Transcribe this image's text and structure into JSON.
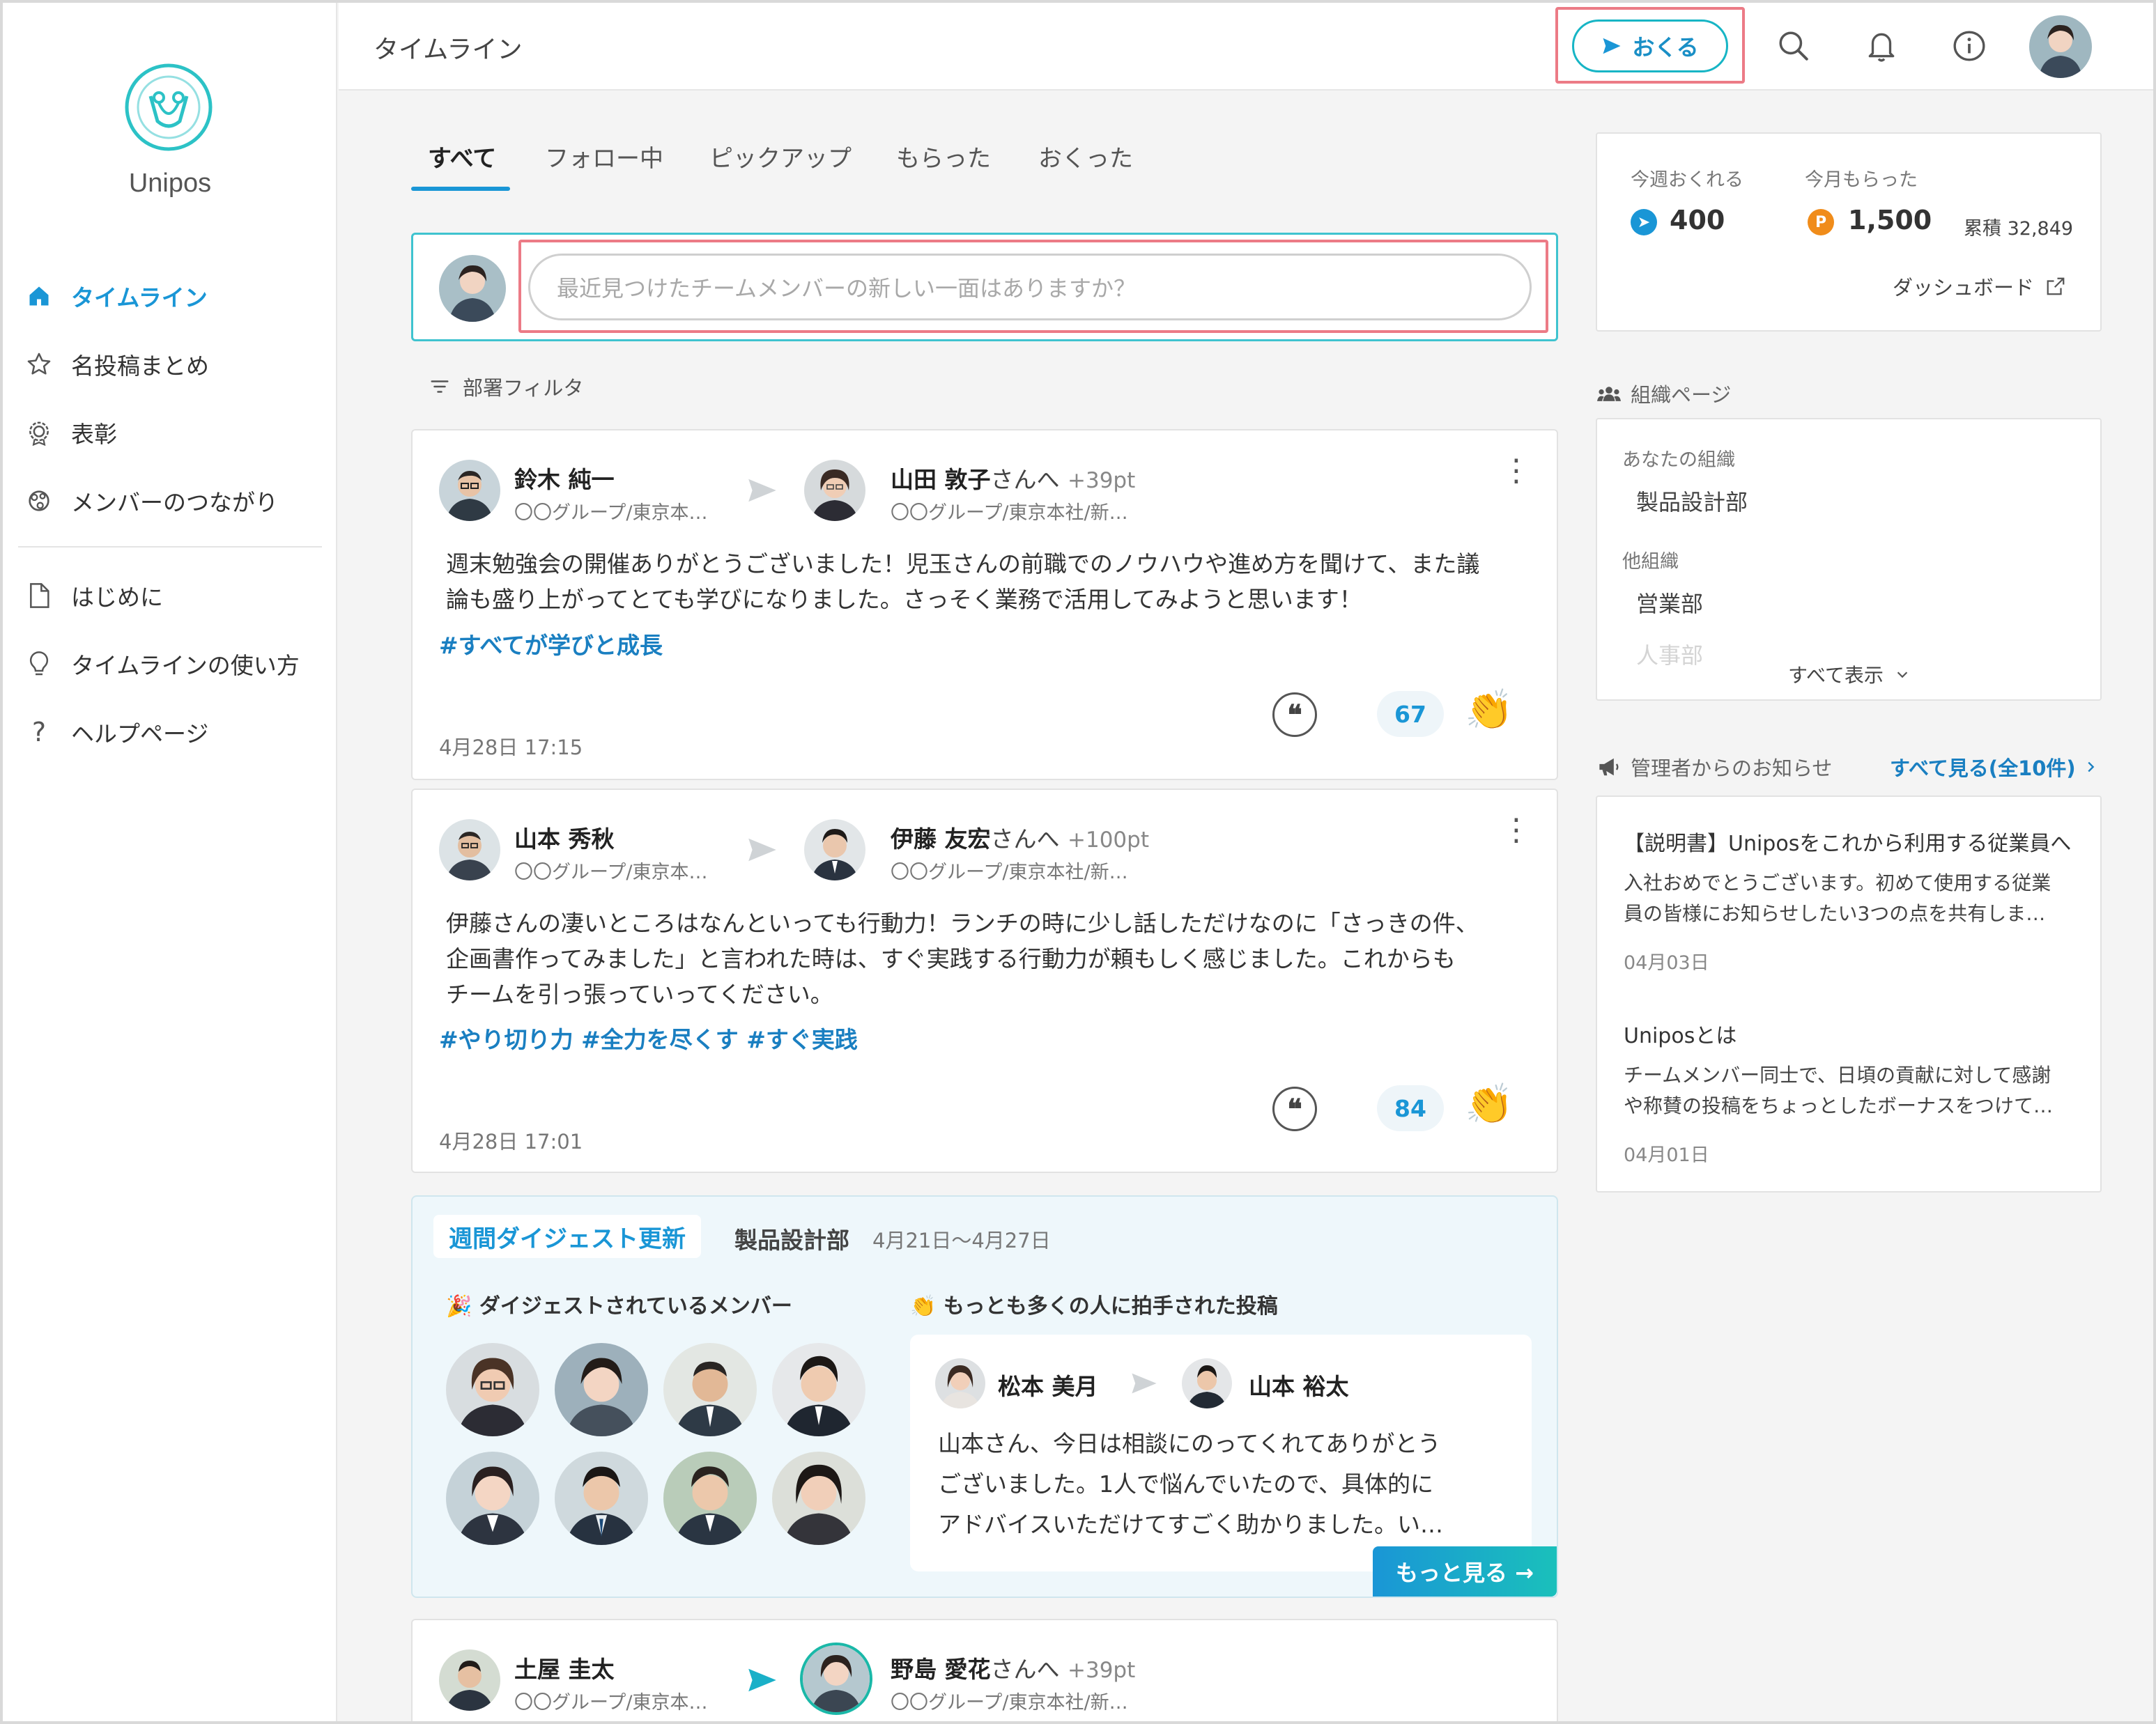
{
  "app": {
    "name": "Unipos",
    "page_title": "タイムライン"
  },
  "sidebar": {
    "items": [
      {
        "label": "タイムライン",
        "icon": "home-icon",
        "active": true
      },
      {
        "label": "名投稿まとめ",
        "icon": "star-icon"
      },
      {
        "label": "表彰",
        "icon": "award-icon"
      },
      {
        "label": "メンバーのつながり",
        "icon": "network-icon"
      }
    ],
    "help_items": [
      {
        "label": "はじめに",
        "icon": "document-icon"
      },
      {
        "label": "タイムラインの使い方",
        "icon": "lightbulb-icon"
      },
      {
        "label": "ヘルプページ",
        "icon": "question-icon"
      }
    ]
  },
  "header": {
    "send_label": "おくる",
    "icons": [
      "search-icon",
      "bell-icon",
      "info-icon"
    ]
  },
  "tabs": [
    "すべて",
    "フォロー中",
    "ピックアップ",
    "もらった",
    "おくった"
  ],
  "composer": {
    "placeholder": "最近見つけたチームメンバーの新しい一面はありますか？"
  },
  "filter_label": "部署フィルタ",
  "posts": [
    {
      "sender": "鈴木 純一",
      "sender_org": "〇〇グループ/東京本…",
      "receiver": "山田 敦子",
      "receiver_suffix": "さんへ",
      "points": "+39pt",
      "receiver_org": "〇〇グループ/東京本社/新…",
      "message_lines": [
        "週末勉強会の開催ありがとうございました！児玉さんの前職でのノウハウや進め方を聞けて、また議",
        "論も盛り上がってとても学びになりました。さっそく業務で活用してみようと思います！"
      ],
      "tags": "#すべてが学びと成長",
      "claps": "67",
      "date": "4月28日 17:15"
    },
    {
      "sender": "山本 秀秋",
      "sender_org": "〇〇グループ/東京本…",
      "receiver": "伊藤 友宏",
      "receiver_suffix": "さんへ",
      "points": "+100pt",
      "receiver_org": "〇〇グループ/東京本社/新…",
      "message_lines": [
        "伊藤さんの凄いところはなんといっても行動力！ランチの時に少し話しただけなのに「さっきの件、",
        "企画書作ってみました」と言われた時は、すぐ実践する行動力が頼もしく感じました。これからも",
        "チームを引っ張っていってください。"
      ],
      "tags": "#やり切り力 #全力を尽くす #すぐ実践",
      "claps": "84",
      "date": "4月28日 17:01"
    },
    {
      "sender": "土屋 圭太",
      "sender_org": "〇〇グループ/東京本…",
      "receiver": "野島 愛花",
      "receiver_suffix": "さんへ",
      "points": "+39pt",
      "receiver_org": "〇〇グループ/東京本社/新…"
    }
  ],
  "digest": {
    "badge": "週間ダイジェスト更新",
    "dept": "製品設計部",
    "range": "4月21日〜4月27日",
    "members_title": "ダイジェストされているメンバー",
    "top_post_title": "もっとも多くの人に拍手された投稿",
    "top_post": {
      "sender": "松本 美月",
      "receiver": "山本 裕太",
      "message_lines": [
        "山本さん、今日は相談にのってくれてありがとう",
        "ございました。1人で悩んでいたので、具体的に",
        "アドバイスいただけてすごく助かりました。い…"
      ]
    },
    "more_label": "もっと見る →"
  },
  "stats": {
    "week_label": "今週おくれる",
    "week_value": "400",
    "month_label": "今月もらった",
    "month_value": "1,500",
    "total_label": "累積 32,849",
    "dashboard_label": "ダッシュボード"
  },
  "org": {
    "section_title": "組織ページ",
    "your_org_label": "あなたの組織",
    "your_org": "製品設計部",
    "other_label": "他組織",
    "other_orgs": [
      "営業部",
      "人事部"
    ],
    "show_all": "すべて表示"
  },
  "announcements": {
    "title": "管理者からのお知らせ",
    "see_all": "すべて見る(全10件)",
    "items": [
      {
        "title": "【説明書】Uniposをこれから利用する従業員へ",
        "body": [
          "入社おめでとうございます。初めて使用する従業",
          "員の皆様にお知らせしたい3つの点を共有しま…"
        ],
        "date": "04月03日"
      },
      {
        "title": "Uniposとは",
        "body": [
          "チームメンバー同士で、日頃の貢献に対して感謝",
          "や称賛の投稿をちょっとしたボーナスをつけて…"
        ],
        "date": "04月01日"
      }
    ]
  },
  "colors": {
    "accent": "#1a96d6",
    "teal": "#17b5c5",
    "highlight": "#ec7b86",
    "coin_orange": "#f08c1a"
  }
}
